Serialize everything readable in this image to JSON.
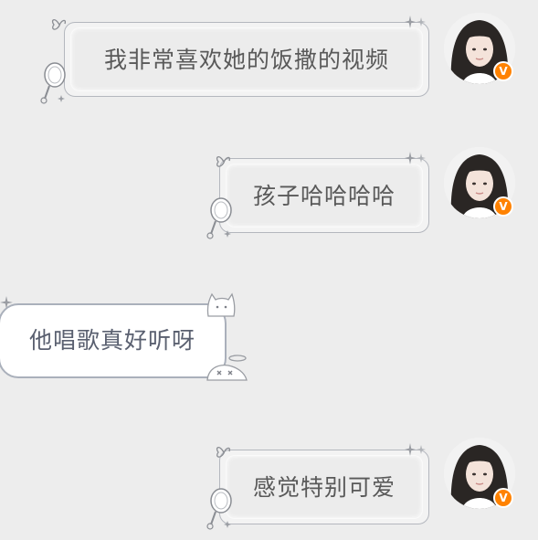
{
  "messages": [
    {
      "side": "right",
      "text": "我非常喜欢她的饭撒的视频"
    },
    {
      "side": "right",
      "text": "孩子哈哈哈哈"
    },
    {
      "side": "left",
      "text": "他唱歌真好听呀"
    },
    {
      "side": "right",
      "text": "感觉特别可爱"
    }
  ],
  "avatar": {
    "verified_badge": "V"
  },
  "colors": {
    "background": "#ededed",
    "badge": "#ff8200",
    "text_right": "#595959",
    "text_left": "#5a6070"
  },
  "icons": {
    "bubble_decor_right": "mirror-butterfly-sparkle-icon",
    "bubble_decor_left": "cat-halo-icon",
    "verified": "verified-badge-icon"
  }
}
